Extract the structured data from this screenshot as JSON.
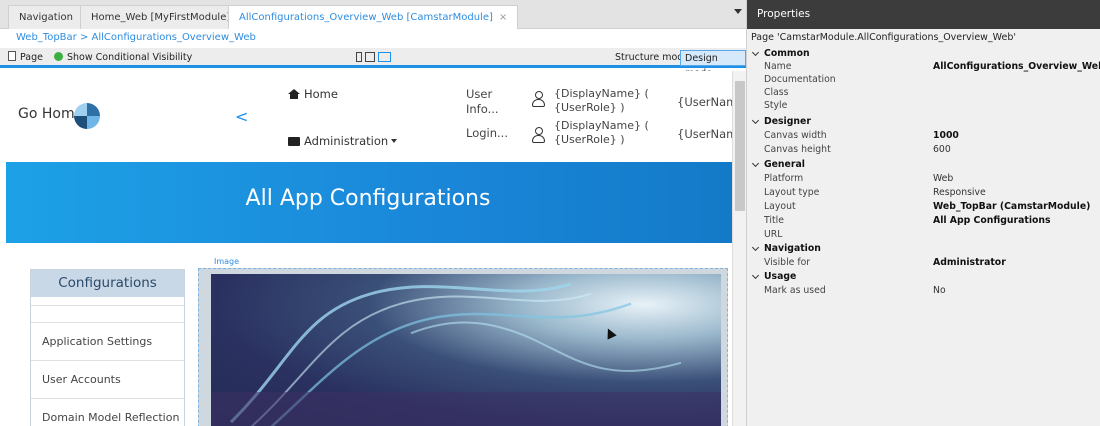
{
  "tabs": [
    {
      "label": "Navigation"
    },
    {
      "label": "Home_Web [MyFirstModule]"
    },
    {
      "label": "AllConfigurations_Overview_Web [CamstarModule]",
      "close": "×"
    }
  ],
  "breadcrumb": "Web_TopBar > AllConfigurations_Overview_Web",
  "toolbar": {
    "page_label": "Page",
    "visibility_label": "Show Conditional Visibility",
    "structure_mode": "Structure mode",
    "design_mode": "Design mode"
  },
  "canvas": {
    "go_home": "Go Home",
    "back": "<",
    "nav_home": "Home",
    "nav_admin": "Administration",
    "user_info": "User\nInfo...",
    "login": "Login...",
    "display_name_1": "{DisplayName} (\n{UserRole} )",
    "display_name_2": "{DisplayName} (\n{UserRole} )",
    "user_name_1": "{UserName",
    "user_name_2": "{UserName",
    "banner_title": "All App Configurations",
    "image_label": "Image",
    "configurations": {
      "heading": "Configurations",
      "items": [
        "Application Settings",
        "User Accounts",
        "Domain Model Reflection"
      ]
    }
  },
  "properties": {
    "title": "Properties",
    "subtitle": "Page 'CamstarModule.AllConfigurations_Overview_Web'",
    "sections": [
      {
        "name": "Common",
        "rows": [
          {
            "key": "Name",
            "value": "AllConfigurations_Overview_Web",
            "bold": true
          },
          {
            "key": "Documentation",
            "value": ""
          },
          {
            "key": "Class",
            "value": ""
          },
          {
            "key": "Style",
            "value": ""
          }
        ]
      },
      {
        "name": "Designer",
        "rows": [
          {
            "key": "Canvas width",
            "value": "1000",
            "bold": true
          },
          {
            "key": "Canvas height",
            "value": "600"
          }
        ]
      },
      {
        "name": "General",
        "rows": [
          {
            "key": "Platform",
            "value": "Web"
          },
          {
            "key": "Layout type",
            "value": "Responsive"
          },
          {
            "key": "Layout",
            "value": "Web_TopBar (CamstarModule)",
            "bold": true
          },
          {
            "key": "Title",
            "value": "All App Configurations",
            "bold": true
          },
          {
            "key": "URL",
            "value": ""
          }
        ]
      },
      {
        "name": "Navigation",
        "rows": [
          {
            "key": "Visible for",
            "value": "Administrator",
            "bold": true
          }
        ]
      },
      {
        "name": "Usage",
        "rows": [
          {
            "key": "Mark as used",
            "value": "No"
          }
        ]
      }
    ]
  }
}
